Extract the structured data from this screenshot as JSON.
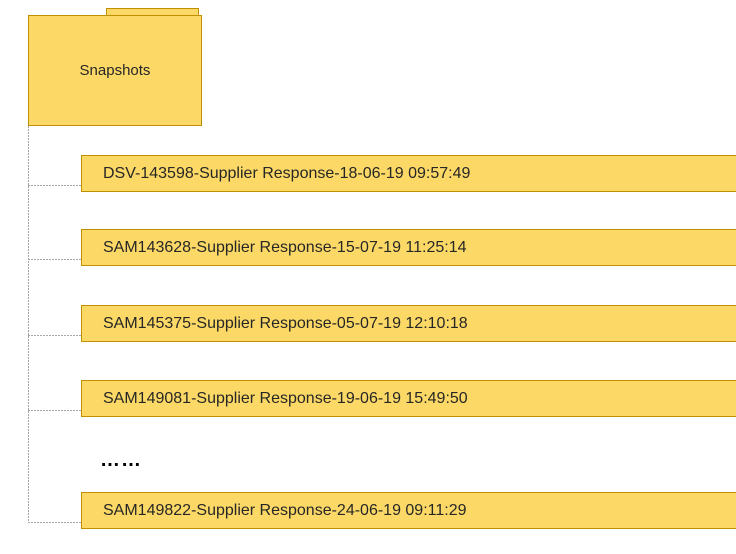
{
  "folder": {
    "label": "Snapshots"
  },
  "snapshots": [
    {
      "label": "DSV-143598-Supplier Response-18-06-19 09:57:49"
    },
    {
      "label": "SAM143628-Supplier Response-15-07-19 11:25:14"
    },
    {
      "label": "SAM145375-Supplier Response-05-07-19 12:10:18"
    },
    {
      "label": "SAM149081-Supplier Response-19-06-19 15:49:50"
    }
  ],
  "ellipsis": "……",
  "last_snapshot": {
    "label": "SAM149822-Supplier Response-24-06-19 09:11:29"
  },
  "colors": {
    "fill": "#fcd966",
    "border": "#bf9000",
    "connector": "#a6a6a6"
  }
}
